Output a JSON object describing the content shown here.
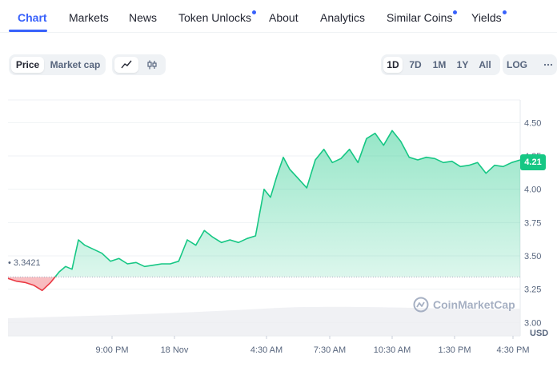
{
  "tabs": [
    {
      "label": "Chart",
      "active": true,
      "dot": false
    },
    {
      "label": "Markets",
      "active": false,
      "dot": false
    },
    {
      "label": "News",
      "active": false,
      "dot": false
    },
    {
      "label": "Token Unlocks",
      "active": false,
      "dot": true
    },
    {
      "label": "About",
      "active": false,
      "dot": false
    },
    {
      "label": "Analytics",
      "active": false,
      "dot": false
    },
    {
      "label": "Similar Coins",
      "active": false,
      "dot": true
    },
    {
      "label": "Yields",
      "active": false,
      "dot": true
    }
  ],
  "toolbar": {
    "price_label": "Price",
    "market_cap_label": "Market cap",
    "line_icon": "line-chart-icon",
    "candle_icon": "candlestick-icon",
    "ranges": [
      "1D",
      "7D",
      "1M",
      "1Y",
      "All"
    ],
    "selected_range": "1D",
    "log_label": "LOG",
    "more_icon": "more-horizontal-icon"
  },
  "chart": {
    "open_price_label": "3.3421",
    "current_price_label": "4.21",
    "watermark": "CoinMarketCap",
    "currency": "USD",
    "colors": {
      "up": "#16c784",
      "down": "#ea3943"
    }
  },
  "chart_data": {
    "type": "area",
    "x_tick_labels": [
      "9:00 PM",
      "18 Nov",
      "4:30 AM",
      "7:30 AM",
      "10:30 AM",
      "1:30 PM",
      "4:30 PM"
    ],
    "y_tick_labels": [
      "3.00",
      "3.25",
      "3.50",
      "3.75",
      "4.00",
      "4.25",
      "4.50"
    ],
    "ylim": [
      2.9,
      4.67
    ],
    "x_range_hours": [
      0,
      24
    ],
    "baseline": 3.3421,
    "current": 4.21,
    "series": [
      {
        "x": [
          0,
          0.4,
          0.8,
          1.2,
          1.6,
          2.0,
          2.4,
          2.7,
          3.0,
          3.3,
          3.6,
          4.0,
          4.4,
          4.8,
          5.2,
          5.6,
          6.0,
          6.4,
          6.8,
          7.2,
          7.6,
          8.0,
          8.4,
          8.8,
          9.2,
          9.6,
          10.0,
          10.4,
          10.8,
          11.2,
          11.6,
          12.0,
          12.3,
          12.6,
          12.9,
          13.2,
          13.6,
          14.0,
          14.4,
          14.8,
          15.2,
          15.6,
          16.0,
          16.4,
          16.8,
          17.2,
          17.6,
          18.0,
          18.4,
          18.8,
          19.2,
          19.6,
          20.0,
          20.4,
          20.8,
          21.2,
          21.6,
          22.0,
          22.4,
          22.8,
          23.2,
          23.6,
          24.0
        ],
        "y": [
          3.33,
          3.31,
          3.3,
          3.28,
          3.24,
          3.3,
          3.38,
          3.42,
          3.4,
          3.62,
          3.58,
          3.55,
          3.52,
          3.46,
          3.48,
          3.44,
          3.45,
          3.42,
          3.43,
          3.44,
          3.44,
          3.46,
          3.62,
          3.58,
          3.69,
          3.64,
          3.6,
          3.62,
          3.6,
          3.63,
          3.65,
          4.0,
          3.94,
          4.1,
          4.24,
          4.15,
          4.08,
          4.01,
          4.22,
          4.3,
          4.2,
          4.23,
          4.3,
          4.2,
          4.38,
          4.42,
          4.33,
          4.44,
          4.36,
          4.24,
          4.22,
          4.24,
          4.23,
          4.2,
          4.21,
          4.17,
          4.18,
          4.2,
          4.12,
          4.18,
          4.17,
          4.2,
          4.22
        ]
      }
    ]
  }
}
